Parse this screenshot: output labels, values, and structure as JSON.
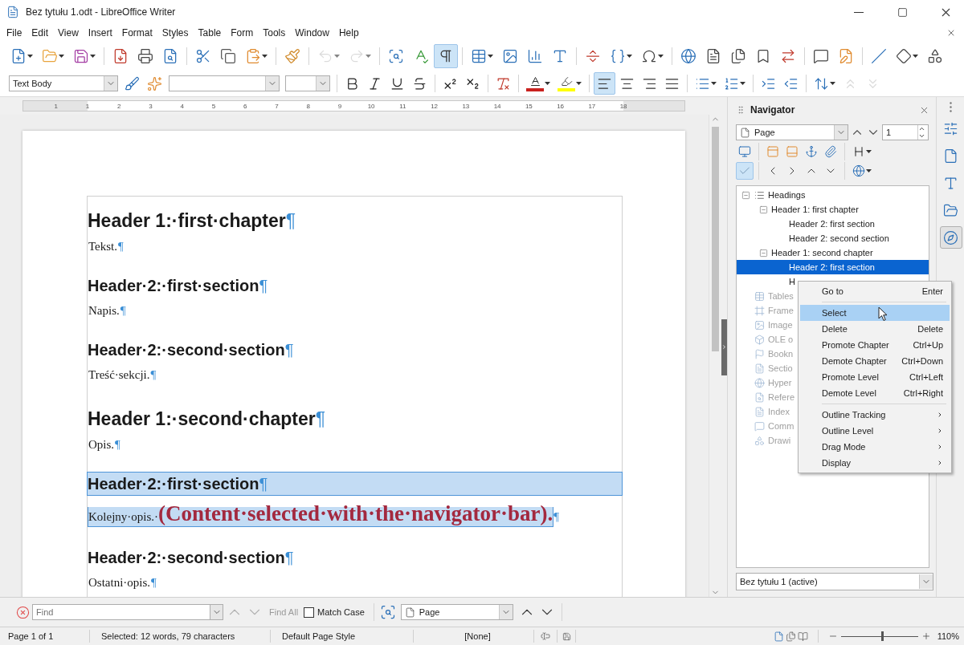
{
  "window": {
    "title": "Bez tytułu 1.odt - LibreOffice Writer"
  },
  "menu": [
    "File",
    "Edit",
    "View",
    "Insert",
    "Format",
    "Styles",
    "Table",
    "Form",
    "Tools",
    "Window",
    "Help"
  ],
  "standard_toolbar": [
    {
      "kind": "new",
      "dropdown": true,
      "on": false,
      "disabled": false
    },
    {
      "kind": "open",
      "dropdown": true,
      "on": false,
      "disabled": false
    },
    {
      "kind": "save",
      "dropdown": true,
      "on": false,
      "disabled": false
    },
    {
      "kind": "separator"
    },
    {
      "kind": "pdf",
      "on": false,
      "disabled": false
    },
    {
      "kind": "print",
      "on": false,
      "disabled": false
    },
    {
      "kind": "preview",
      "on": false,
      "disabled": false
    },
    {
      "kind": "separator"
    },
    {
      "kind": "cut",
      "on": false,
      "disabled": false
    },
    {
      "kind": "copy",
      "on": false,
      "disabled": false
    },
    {
      "kind": "paste",
      "dropdown": true,
      "on": false,
      "disabled": false
    },
    {
      "kind": "separator"
    },
    {
      "kind": "clone",
      "on": false,
      "disabled": false
    },
    {
      "kind": "separator"
    },
    {
      "kind": "undo",
      "dropdown": true,
      "on": false,
      "disabled": true
    },
    {
      "kind": "redo",
      "dropdown": true,
      "on": false,
      "disabled": true
    },
    {
      "kind": "separator"
    },
    {
      "kind": "find",
      "on": false,
      "disabled": false
    },
    {
      "kind": "spelling",
      "on": false,
      "disabled": false
    },
    {
      "kind": "marks",
      "on": true,
      "disabled": false
    },
    {
      "kind": "separator"
    },
    {
      "kind": "table",
      "dropdown": true,
      "on": false,
      "disabled": false
    },
    {
      "kind": "image",
      "on": false,
      "disabled": false
    },
    {
      "kind": "chart",
      "on": false,
      "disabled": false
    },
    {
      "kind": "textbox",
      "on": false,
      "disabled": false
    },
    {
      "kind": "separator"
    },
    {
      "kind": "pagebreak",
      "on": false,
      "disabled": false
    },
    {
      "kind": "field",
      "dropdown": true,
      "on": false,
      "disabled": false
    },
    {
      "kind": "special",
      "dropdown": true,
      "on": false,
      "disabled": false
    },
    {
      "kind": "separator"
    },
    {
      "kind": "hyperlink",
      "on": false,
      "disabled": false
    },
    {
      "kind": "footnote",
      "on": false,
      "disabled": false
    },
    {
      "kind": "endnote",
      "on": false,
      "disabled": false
    },
    {
      "kind": "bookmark",
      "on": false,
      "disabled": false
    },
    {
      "kind": "crossref",
      "on": false,
      "disabled": false
    },
    {
      "kind": "separator"
    },
    {
      "kind": "comment",
      "on": false,
      "disabled": false
    },
    {
      "kind": "track",
      "on": false,
      "disabled": false
    },
    {
      "kind": "separator"
    },
    {
      "kind": "line",
      "on": false,
      "disabled": false
    },
    {
      "kind": "shapes",
      "dropdown": true,
      "on": false,
      "disabled": false
    },
    {
      "kind": "more",
      "on": false,
      "disabled": false
    }
  ],
  "formatting_toolbar": [
    {
      "kind": "style-combo",
      "value": "Text Body"
    },
    {
      "kind": "updatestyle",
      "on": false,
      "disabled": false
    },
    {
      "kind": "newstyle",
      "on": false,
      "disabled": false
    },
    {
      "kind": "font-combo"
    },
    {
      "kind": "size-combo"
    },
    {
      "kind": "separator"
    },
    {
      "kind": "bold",
      "on": false,
      "disabled": false
    },
    {
      "kind": "italic",
      "on": false,
      "disabled": false
    },
    {
      "kind": "underline",
      "on": false,
      "disabled": false
    },
    {
      "kind": "strike",
      "on": false,
      "disabled": false
    },
    {
      "kind": "separator"
    },
    {
      "kind": "sup",
      "on": false,
      "disabled": false
    },
    {
      "kind": "sub",
      "on": false,
      "disabled": false
    },
    {
      "kind": "separator"
    },
    {
      "kind": "clear",
      "on": false,
      "disabled": false
    },
    {
      "kind": "separator"
    },
    {
      "kind": "fontcolor",
      "dropdown": true,
      "color": "#c9211e",
      "on": false,
      "disabled": false
    },
    {
      "kind": "highlight",
      "dropdown": true,
      "color": "#ffff00",
      "on": false,
      "disabled": false
    },
    {
      "kind": "separator"
    },
    {
      "kind": "left",
      "on": true,
      "disabled": false
    },
    {
      "kind": "center",
      "on": false,
      "disabled": false
    },
    {
      "kind": "right",
      "on": false,
      "disabled": false
    },
    {
      "kind": "justify",
      "on": false,
      "disabled": false
    },
    {
      "kind": "separator"
    },
    {
      "kind": "bullets",
      "dropdown": true,
      "on": false,
      "disabled": false
    },
    {
      "kind": "numbering",
      "dropdown": true,
      "on": false,
      "disabled": false
    },
    {
      "kind": "separator"
    },
    {
      "kind": "indent",
      "on": false,
      "disabled": false
    },
    {
      "kind": "outdent",
      "on": false,
      "disabled": false
    },
    {
      "kind": "separator"
    },
    {
      "kind": "linespacing",
      "dropdown": true,
      "on": false,
      "disabled": false
    },
    {
      "kind": "paraup",
      "on": false,
      "disabled": true
    },
    {
      "kind": "paradown",
      "on": false,
      "disabled": true
    }
  ],
  "ruler": {
    "labels": [
      "1",
      "1",
      "2",
      "3",
      "4",
      "5",
      "6",
      "7",
      "8",
      "9",
      "10",
      "11",
      "12",
      "13",
      "14",
      "15",
      "16",
      "17",
      "18"
    ]
  },
  "document": {
    "paragraphs": [
      {
        "kind": "heading1",
        "text": "Header 1:·first·chapter",
        "mark": "¶",
        "selected": false
      },
      {
        "kind": "body",
        "runs": [
          {
            "kind": "plain",
            "text": "Tekst."
          }
        ],
        "mark": "¶",
        "selected": false
      },
      {
        "kind": "heading2",
        "text": "Header·2:·first·section",
        "mark": "¶",
        "selected": false
      },
      {
        "kind": "body",
        "runs": [
          {
            "kind": "plain",
            "text": "Napis."
          }
        ],
        "mark": "¶",
        "selected": false
      },
      {
        "kind": "heading2",
        "text": "Header·2:·second·section",
        "mark": "¶",
        "selected": false
      },
      {
        "kind": "body",
        "runs": [
          {
            "kind": "plain",
            "text": "Treść·sekcji."
          }
        ],
        "mark": "¶",
        "selected": false
      },
      {
        "kind": "heading1",
        "text": "Header 1:·second·chapter",
        "mark": "¶",
        "selected": false
      },
      {
        "kind": "body",
        "runs": [
          {
            "kind": "plain",
            "text": "Opis."
          }
        ],
        "mark": "¶",
        "selected": false
      },
      {
        "kind": "heading2",
        "text": "Header·2:·first·section",
        "mark": "¶",
        "selected": true
      },
      {
        "kind": "body",
        "runs": [
          {
            "kind": "plain",
            "text": "Kolejny·opis.·"
          },
          {
            "kind": "annotation",
            "text": "(Content·selected·with·the·navigator·bar)."
          }
        ],
        "mark": "¶",
        "selected": true
      },
      {
        "kind": "heading2",
        "text": "Header·2:·second·section",
        "mark": "¶",
        "selected": false
      },
      {
        "kind": "body",
        "runs": [
          {
            "kind": "plain",
            "text": "Ostatni·opis."
          }
        ],
        "mark": "¶",
        "selected": false
      }
    ]
  },
  "navigator": {
    "title": "Navigator",
    "navigate_by": "Page",
    "page_number": "1",
    "tools_1": [
      {
        "kind": "content",
        "on": false
      },
      {
        "kind": "separator"
      },
      {
        "kind": "header",
        "on": false
      },
      {
        "kind": "footer",
        "on": false
      },
      {
        "kind": "anchor",
        "on": false
      },
      {
        "kind": "reminder",
        "on": false
      },
      {
        "kind": "separator"
      },
      {
        "kind": "heading",
        "dropdown": true,
        "on": false
      }
    ],
    "tools_2": [
      {
        "kind": "check",
        "on": true
      },
      {
        "kind": "separator"
      },
      {
        "kind": "prev",
        "on": false
      },
      {
        "kind": "next",
        "on": false
      },
      {
        "kind": "up",
        "on": false
      },
      {
        "kind": "down",
        "on": false
      },
      {
        "kind": "separator"
      },
      {
        "kind": "drag",
        "dropdown": true,
        "on": false
      }
    ],
    "tree": [
      {
        "kind": "headings",
        "label": "Headings",
        "expanded": true,
        "selected": false,
        "disabled": false,
        "children": [
          {
            "label": "Header 1: first chapter",
            "expanded": true,
            "selected": false,
            "children": [
              {
                "label": "Header 2: first section",
                "selected": false
              },
              {
                "label": "Header 2: second section",
                "selected": false
              }
            ]
          },
          {
            "label": "Header 1: second chapter",
            "expanded": true,
            "selected": false,
            "children": [
              {
                "label": "Header 2: first section",
                "selected": true
              },
              {
                "label": "H",
                "selected": false
              }
            ]
          }
        ]
      },
      {
        "kind": "tables",
        "label": "Tables",
        "selected": false,
        "disabled": true
      },
      {
        "kind": "frames",
        "label": "Frame",
        "selected": false,
        "disabled": true
      },
      {
        "kind": "images",
        "label": "Image",
        "selected": false,
        "disabled": true
      },
      {
        "kind": "ole",
        "label": "OLE o",
        "selected": false,
        "disabled": true
      },
      {
        "kind": "bookmarks",
        "label": "Bookn",
        "selected": false,
        "disabled": true
      },
      {
        "kind": "sections",
        "label": "Sectio",
        "selected": false,
        "disabled": true
      },
      {
        "kind": "hyperlinks",
        "label": "Hyper",
        "selected": false,
        "disabled": true
      },
      {
        "kind": "references",
        "label": "Refere",
        "selected": false,
        "disabled": true
      },
      {
        "kind": "indexes",
        "label": "Index",
        "selected": false,
        "disabled": true
      },
      {
        "kind": "comments",
        "label": "Comm",
        "selected": false,
        "disabled": true
      },
      {
        "kind": "drawings",
        "label": "Drawi",
        "selected": false,
        "disabled": true
      }
    ],
    "document": "Bez tytułu 1 (active)"
  },
  "context_menu": [
    {
      "kind": "item",
      "label": "Go to",
      "shortcut": "Enter",
      "hovered": false
    },
    {
      "kind": "separator"
    },
    {
      "kind": "item",
      "label": "Select",
      "hovered": true
    },
    {
      "kind": "item",
      "label": "Delete",
      "shortcut": "Delete",
      "hovered": false
    },
    {
      "kind": "item",
      "label": "Promote Chapter",
      "shortcut": "Ctrl+Up",
      "hovered": false
    },
    {
      "kind": "item",
      "label": "Demote Chapter",
      "shortcut": "Ctrl+Down",
      "hovered": false
    },
    {
      "kind": "item",
      "label": "Promote Level",
      "shortcut": "Ctrl+Left",
      "hovered": false
    },
    {
      "kind": "item",
      "label": "Demote Level",
      "shortcut": "Ctrl+Right",
      "hovered": false
    },
    {
      "kind": "separator"
    },
    {
      "kind": "submenu",
      "label": "Outline Tracking",
      "hovered": false
    },
    {
      "kind": "submenu",
      "label": "Outline Level",
      "hovered": false
    },
    {
      "kind": "submenu",
      "label": "Drag Mode",
      "hovered": false
    },
    {
      "kind": "submenu",
      "label": "Display",
      "hovered": false
    }
  ],
  "sidebar_tabs": [
    {
      "kind": "properties",
      "selected": false
    },
    {
      "kind": "page",
      "selected": false
    },
    {
      "kind": "styles",
      "selected": false
    },
    {
      "kind": "gallery",
      "selected": false
    },
    {
      "kind": "navigator",
      "selected": true
    }
  ],
  "find_bar": {
    "placeholder": "Find",
    "find_arrows_disabled": true,
    "find_all": {
      "label": "Find All",
      "disabled": true
    },
    "match_case": {
      "label": "Match Case",
      "checked": false
    },
    "search_by": "Page",
    "nav_arrows_disabled": false
  },
  "status_bar": {
    "page": "Page 1 of 1",
    "selection": "Selected: 12 words, 79 characters",
    "page_style": "Default Page Style",
    "language": "[None]",
    "view_layouts": [
      {
        "kind": "single",
        "selected": true
      },
      {
        "kind": "multi",
        "selected": false
      },
      {
        "kind": "book",
        "selected": false
      }
    ],
    "zoom": {
      "level": 0.53,
      "reading": "110%"
    }
  }
}
